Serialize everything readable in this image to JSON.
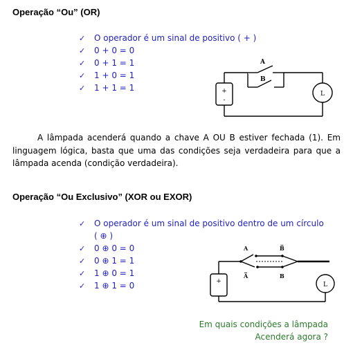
{
  "or_section": {
    "title": "Operação “Ou” (OR)",
    "bullets": [
      "O operador é um sinal de positivo ( + )",
      "0 + 0 = 0",
      "0 + 1 = 1",
      "1 + 0 = 1",
      "1 + 1 = 1"
    ],
    "paragraph": "A lâmpada acenderá quando a chave A OU B estiver fechada (1). Em linguagem lógica, basta que uma das condições seja verdadeira para que a lâmpada acenda (condição verdadeira).",
    "circuit": {
      "switch_a": "A",
      "switch_b": "B",
      "battery_plus": "+",
      "battery_minus": "-",
      "lamp": "L"
    }
  },
  "xor_section": {
    "title": "Operação “Ou Exclusivo” (XOR ou EXOR)",
    "bullets": [
      "O operador é um sinal de positivo dentro de um círculo",
      "0 ⊕ 0 = 0",
      "0 ⊕ 1 = 1",
      "1 ⊕ 0 = 1",
      "1 ⊕ 1 = 0"
    ],
    "bullet_continuation": "( ⊕ )",
    "circuit": {
      "top_left": "A",
      "top_right": "B̅",
      "bottom_left": "A̅",
      "bottom_right": "B",
      "battery_plus": "+",
      "lamp": "L"
    },
    "question_line1": "Em quais condições a lâmpada",
    "question_line2": "Acenderá agora ?"
  },
  "colors": {
    "bullet_text": "#1f1fbf",
    "question_text": "#2a7a2a"
  }
}
